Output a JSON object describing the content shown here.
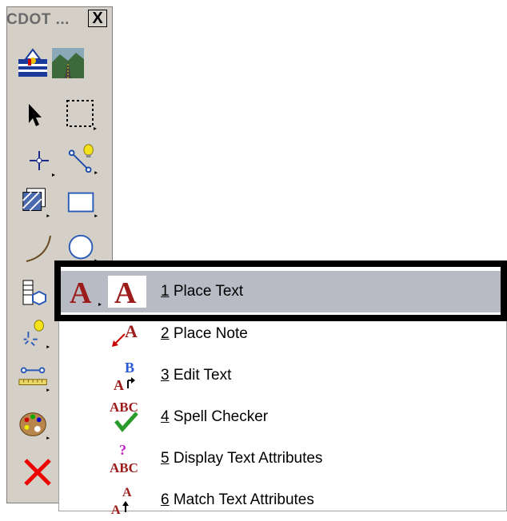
{
  "toolbox": {
    "title": "CDOT ...",
    "close_glyph": "X"
  },
  "menu": {
    "items": [
      {
        "num": "1",
        "label": "Place Text",
        "selected": true
      },
      {
        "num": "2",
        "label": "Place Note",
        "selected": false
      },
      {
        "num": "3",
        "label": "Edit Text",
        "selected": false
      },
      {
        "num": "4",
        "label": "Spell Checker",
        "selected": false
      },
      {
        "num": "5",
        "label": "Display Text Attributes",
        "selected": false
      },
      {
        "num": "6",
        "label": "Match Text Attributes",
        "selected": false
      }
    ],
    "icons": {
      "place_text_glyph": "A",
      "place_note_glyph": "A",
      "edit_text_glyph_top": "B",
      "edit_text_glyph_bottom": "A",
      "spell_glyph": "ABC",
      "display_glyph_top": "?",
      "display_glyph_bottom": "ABC",
      "match_glyph_top": "A",
      "match_glyph_bottom": "A"
    }
  },
  "colors": {
    "toolbox_bg": "#d4d0c8",
    "selected_bg": "#b8bac4",
    "text_red": "#9c1c1c"
  }
}
